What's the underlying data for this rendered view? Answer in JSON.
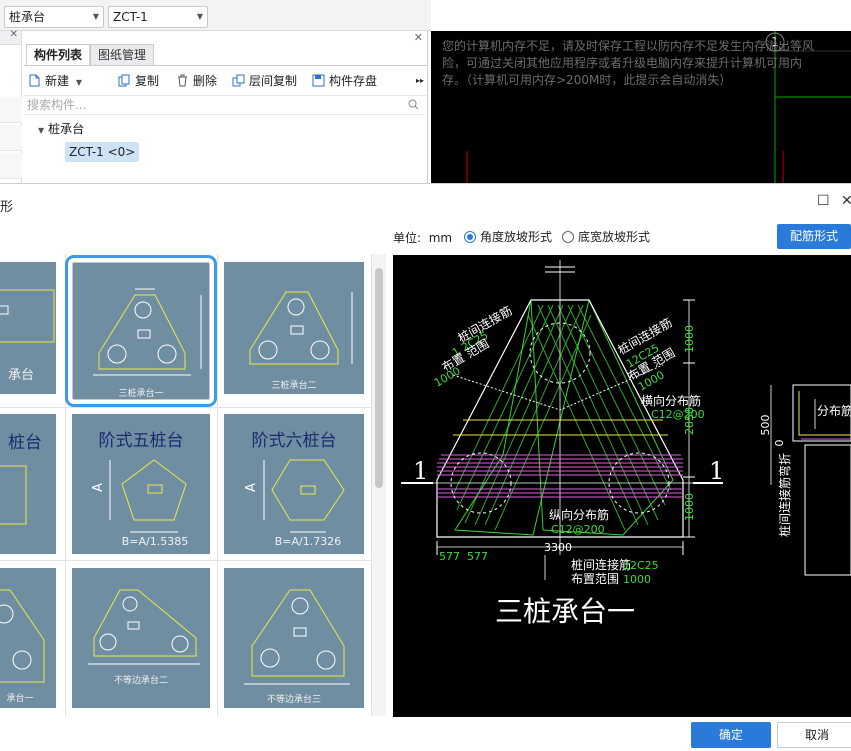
{
  "toolbar": {
    "type_select": "桩承台",
    "name_select": "ZCT-1"
  },
  "component_panel": {
    "tabs": [
      "构件列表",
      "图纸管理"
    ],
    "actions": {
      "new": "新建",
      "copy": "复制",
      "delete": "删除",
      "floor_copy": "层间复制",
      "save": "构件存盘"
    },
    "search_placeholder": "搜索构件...",
    "tree": {
      "group": "桩承台",
      "item": "ZCT-1 <0>"
    }
  },
  "cad_top": {
    "message": "您的计算机内存不足，请及时保存工程以防内存不足发生内存溢出等风险，可通过关闭其他应用程序或者升级电脑内存来提升计算机可用内存。（计算机可用内存>200M时，此提示会自动消失）",
    "marker": "1"
  },
  "dialog": {
    "title_fragment": "形",
    "unit_label": "单位:",
    "unit_value": "mm",
    "radio_angle": "角度放坡形式",
    "radio_width": "底宽放坡形式",
    "rebar_button": "配筋形式",
    "ok_button": "确定",
    "cancel_button": "取消",
    "grid": [
      {
        "caption": "承台"
      },
      {
        "caption": "三桩承台一",
        "selected": true
      },
      {
        "caption": "三桩承台二"
      },
      {
        "title": "桩台"
      },
      {
        "title": "阶式五桩台",
        "dim_a": "A",
        "formula": "B=A/1.5385"
      },
      {
        "title": "阶式六桩台",
        "dim_a": "A",
        "formula": "B=A/1.7326"
      },
      {
        "caption": "承台一"
      },
      {
        "caption": "不等边承台二"
      },
      {
        "caption": "不等边承台三"
      }
    ]
  },
  "preview": {
    "title": "三桩承台一",
    "section_mark": "1",
    "dims": {
      "top": "1000",
      "middle": "2858",
      "bottom": "1000",
      "width": "3300",
      "left_a": "577",
      "left_b": "577",
      "side_500": "500",
      "side_0": "0"
    },
    "labels": {
      "tie_left": "桩间连接筋",
      "tie_left_spec": "1 2C25",
      "range_left": "布置 范围",
      "range_left_value": "1000",
      "tie_right": "桩间连接筋",
      "tie_right_spec": "12C25",
      "range_right": "布置 范围",
      "range_right_value": "1000",
      "horizontal": "横向分布筋",
      "horizontal_spec": "C12@200",
      "vertical": "纵向分布筋",
      "vertical_spec": "C12@200",
      "tie_bottom": "桩间连接筋",
      "tie_bottom_spec": "12C25",
      "range_bottom": "布置范围",
      "range_bottom_value": "1000",
      "distribution": "分布筋",
      "side_vertical": "桩间连接筋弯折"
    }
  }
}
